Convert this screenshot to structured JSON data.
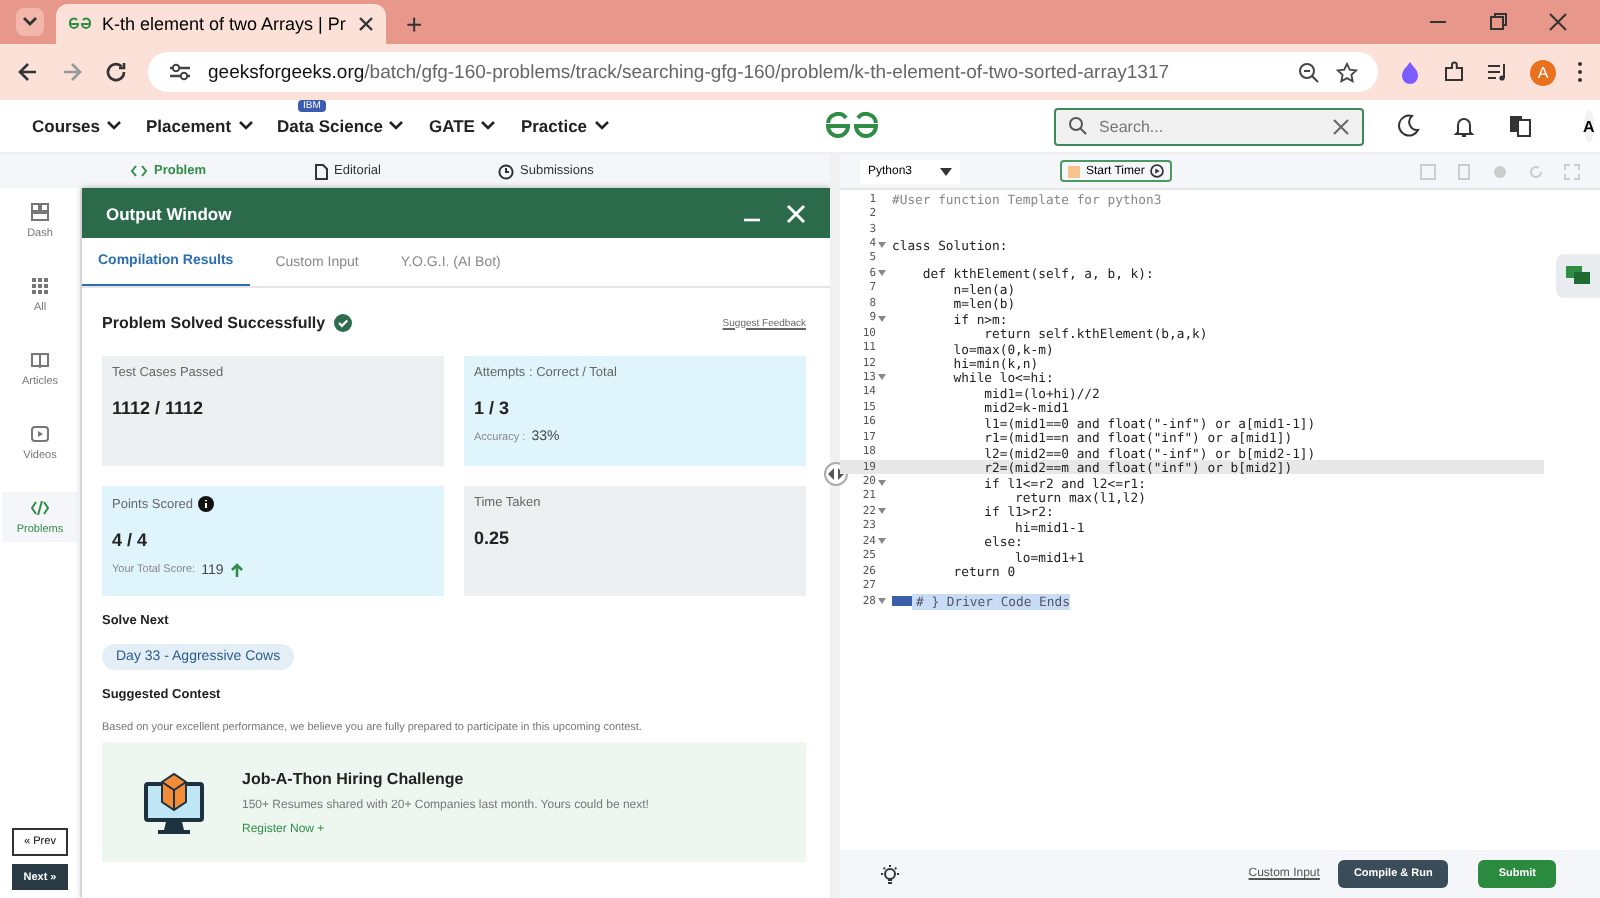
{
  "browser": {
    "tab_title": "K-th element of two Arrays | Pr",
    "new_tab": "+",
    "url_host": "geeksforgeeks.org",
    "url_path": "/batch/gfg-160-problems/track/searching-gfg-160/problem/k-th-element-of-two-sorted-array1317",
    "profile": "A"
  },
  "site_nav": {
    "items": [
      {
        "label": "Courses"
      },
      {
        "label": "Placement"
      },
      {
        "label": "Data Science",
        "badge": "IBM"
      },
      {
        "label": "GATE"
      },
      {
        "label": "Practice"
      }
    ],
    "search": {
      "placeholder": "Search..."
    },
    "avatar": "A"
  },
  "problem_tabs": [
    {
      "label": "Problem",
      "selected": true
    },
    {
      "label": "Editorial",
      "selected": false
    },
    {
      "label": "Submissions",
      "selected": false
    }
  ],
  "sidebar": {
    "items": [
      {
        "label": "Dash",
        "selected": false
      },
      {
        "label": "All",
        "selected": false
      },
      {
        "label": "Articles",
        "selected": false
      },
      {
        "label": "Videos",
        "selected": false
      },
      {
        "label": "Problems",
        "selected": true
      }
    ],
    "prev": "« Prev",
    "next": "Next »"
  },
  "output_window": {
    "title": "Output Window",
    "tabs": [
      {
        "label": "Compilation Results",
        "selected": true
      },
      {
        "label": "Custom Input",
        "selected": false
      },
      {
        "label": "Y.O.G.I. (AI Bot)",
        "selected": false
      }
    ],
    "status": "Problem Solved Successfully",
    "feedback_link": "Suggest Feedback",
    "stats": [
      {
        "label": "Test Cases Passed",
        "value": "1112 / 1112",
        "highlight": false
      },
      {
        "label": "Attempts : Correct / Total",
        "value": "1 / 3",
        "note_label": "Accuracy :",
        "note_value": "33%",
        "highlight": true
      },
      {
        "label": "Points Scored",
        "value": "4 / 4",
        "note_label": "Your Total Score:",
        "note_value": "119",
        "highlight": true
      },
      {
        "label": "Time Taken",
        "value": "0.25",
        "highlight": false
      }
    ],
    "solve_next_heading": "Solve Next",
    "solve_next": "Day 33 - Aggressive Cows",
    "contest_heading": "Suggested Contest",
    "contest_text": "Based on your excellent performance, we believe you are fully prepared to participate in this upcoming contest.",
    "contest": {
      "title": "Job-A-Thon Hiring Challenge",
      "description": "150+ Resumes shared with 20+ Companies last month. Yours could be next!",
      "link": "Register Now +"
    }
  },
  "editor": {
    "language": "Python3",
    "timer": "Start Timer",
    "lines": [
      {
        "number": "1",
        "text": "#User function Template for python3",
        "kind": "comment",
        "foldable": false,
        "selected": false
      },
      {
        "number": "2",
        "kind": "code",
        "foldable": false,
        "selected": false
      },
      {
        "number": "3",
        "kind": "code",
        "foldable": false,
        "selected": false
      },
      {
        "number": "4",
        "text": "class Solution:",
        "kind": "code",
        "foldable": true,
        "selected": false
      },
      {
        "number": "5",
        "kind": "code",
        "foldable": false,
        "selected": false
      },
      {
        "number": "6",
        "text": "    def kthElement(self, a, b, k):",
        "kind": "code",
        "foldable": true,
        "selected": false
      },
      {
        "number": "7",
        "text": "        n=len(a)",
        "kind": "code",
        "foldable": false,
        "selected": false
      },
      {
        "number": "8",
        "text": "        m=len(b)",
        "kind": "code",
        "foldable": false,
        "selected": false
      },
      {
        "number": "9",
        "text": "        if n>m:",
        "kind": "code",
        "foldable": true,
        "selected": false
      },
      {
        "number": "10",
        "text": "            return self.kthElement(b,a,k)",
        "kind": "code",
        "foldable": false,
        "selected": false
      },
      {
        "number": "11",
        "text": "        lo=max(0,k-m)",
        "kind": "code",
        "foldable": false,
        "selected": false
      },
      {
        "number": "12",
        "text": "        hi=min(k,n)",
        "kind": "code",
        "foldable": false,
        "selected": false
      },
      {
        "number": "13",
        "text": "        while lo<=hi:",
        "kind": "code",
        "foldable": true,
        "selected": false
      },
      {
        "number": "14",
        "text": "            mid1=(lo+hi)//2",
        "kind": "code",
        "foldable": false,
        "selected": false
      },
      {
        "number": "15",
        "text": "            mid2=k-mid1",
        "kind": "code",
        "foldable": false,
        "selected": false
      },
      {
        "number": "16",
        "text": "            l1=(mid1==0 and float(\"-inf\") or a[mid1-1])",
        "kind": "code",
        "foldable": false,
        "selected": false
      },
      {
        "number": "17",
        "text": "            r1=(mid1==n and float(\"inf\") or a[mid1])",
        "kind": "code",
        "foldable": false,
        "selected": false
      },
      {
        "number": "18",
        "text": "            l2=(mid2==0 and float(\"-inf\") or b[mid2-1])",
        "kind": "code",
        "foldable": false,
        "selected": false
      },
      {
        "number": "19",
        "text": "            r2=(mid2==m and float(\"inf\") or b[mid2])",
        "kind": "code",
        "foldable": false,
        "selected": true
      },
      {
        "number": "20",
        "text": "            if l1<=r2 and l2<=r1:",
        "kind": "code",
        "foldable": true,
        "selected": false
      },
      {
        "number": "21",
        "text": "                return max(l1,l2)",
        "kind": "code",
        "foldable": false,
        "selected": false
      },
      {
        "number": "22",
        "text": "            if l1>r2:",
        "kind": "code",
        "foldable": true,
        "selected": false
      },
      {
        "number": "23",
        "text": "                hi=mid1-1",
        "kind": "code",
        "foldable": false,
        "selected": false
      },
      {
        "number": "24",
        "text": "            else:",
        "kind": "code",
        "foldable": true,
        "selected": false
      },
      {
        "number": "25",
        "text": "                lo=mid1+1",
        "kind": "code",
        "foldable": false,
        "selected": false
      },
      {
        "number": "26",
        "text": "        return 0",
        "kind": "code",
        "foldable": false,
        "selected": false
      },
      {
        "number": "27",
        "kind": "code",
        "foldable": false,
        "selected": false
      },
      {
        "number": "28",
        "text": "# } Driver Code Ends",
        "kind": "marked",
        "foldable": true,
        "selected": false
      }
    ],
    "custom_input": "Custom Input",
    "compile": "Compile & Run",
    "submit": "Submit"
  }
}
